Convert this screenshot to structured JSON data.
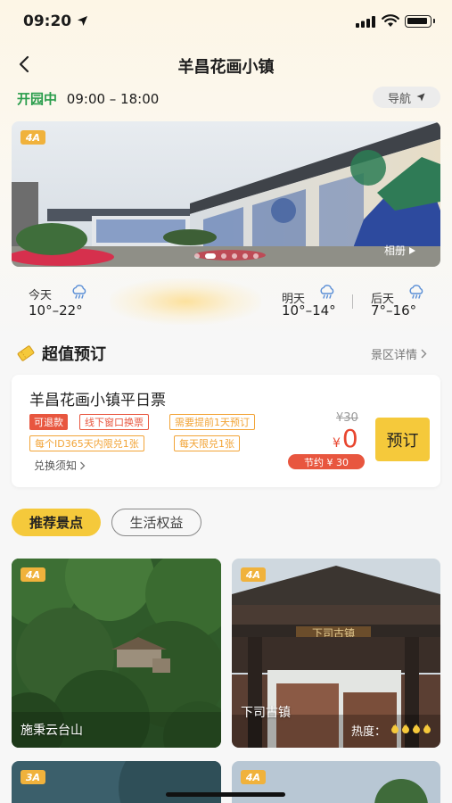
{
  "status_bar": {
    "time": "09:20"
  },
  "header": {
    "title": "羊昌花画小镇"
  },
  "open_info": {
    "status": "开园中",
    "hours": "09:00 – 18:00",
    "nav_label": "导航"
  },
  "banner": {
    "badge": "4A",
    "album_label": "相册",
    "slides": 6,
    "active_slide": 1
  },
  "weather": [
    {
      "day": "今天",
      "temp": "10°–22°",
      "icon": "cloud-rain-icon"
    },
    {
      "day": "明天",
      "temp": "10°–14°",
      "icon": "cloud-rain-icon"
    },
    {
      "day": "后天",
      "temp": "7°–16°",
      "icon": "cloud-rain-icon"
    }
  ],
  "booking": {
    "title": "超值预订",
    "detail_link": "景区详情",
    "ticket": {
      "name": "羊昌花画小镇平日票",
      "tags": [
        "可退款",
        "线下窗口换票",
        "需要提前1天预订",
        "每个ID365天内限兑1张",
        "每天限兑1张"
      ],
      "exchange_notice": "兑换须知",
      "original_price": "¥30",
      "currency": "¥",
      "price": "0",
      "saving": "节约 ¥ 30",
      "book_label": "预订"
    }
  },
  "tabs": [
    "推荐景点",
    "生活权益"
  ],
  "spots": [
    {
      "badge": "4A",
      "name": "施秉云台山",
      "heat_label": ""
    },
    {
      "badge": "4A",
      "name": "下司古镇",
      "heat_label": "热度：",
      "heat_stars": 4,
      "gate_sign": "下司古镇"
    },
    {
      "badge": "3A",
      "name": ""
    },
    {
      "badge": "4A",
      "name": ""
    }
  ],
  "colors": {
    "accent_yellow": "#f5c93b",
    "price_red": "#e8462f",
    "open_green": "#2a9d4c",
    "tag_orange": "#f2a437"
  }
}
